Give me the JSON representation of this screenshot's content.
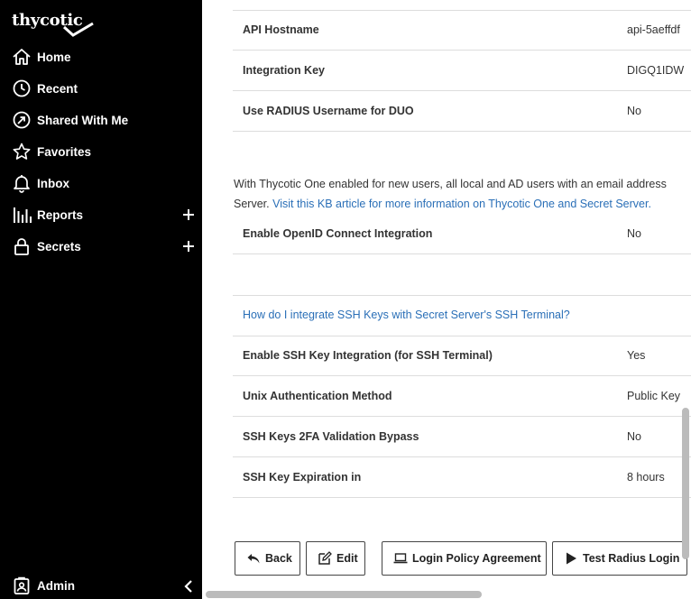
{
  "sidebar": {
    "logo": "thycotic",
    "items": [
      {
        "label": "Home"
      },
      {
        "label": "Recent"
      },
      {
        "label": "Shared With Me"
      },
      {
        "label": "Favorites"
      },
      {
        "label": "Inbox"
      },
      {
        "label": "Reports"
      },
      {
        "label": "Secrets"
      }
    ],
    "admin": "Admin"
  },
  "settings": {
    "api_hostname": {
      "label": "API Hostname",
      "value": "api-5aeffdf"
    },
    "integration_key": {
      "label": "Integration Key",
      "value": "DIGQ1IDW"
    },
    "radius_duo": {
      "label": "Use RADIUS Username for DUO",
      "value": "No"
    },
    "paragraph_text": "With Thycotic One enabled for new users, all local and AD users with an email address",
    "paragraph_text2": "Server. ",
    "paragraph_link": "Visit this KB article for more information on Thycotic One and Secret Server.",
    "openid": {
      "label": "Enable OpenID Connect Integration",
      "value": "No"
    },
    "ssh_kb_link": "How do I integrate SSH Keys with Secret Server's SSH Terminal?",
    "ssh_key_integration": {
      "label": "Enable SSH Key Integration (for SSH Terminal)",
      "value": "Yes"
    },
    "unix_auth": {
      "label": "Unix Authentication Method",
      "value": "Public Key"
    },
    "ssh_2fa": {
      "label": "SSH Keys 2FA Validation Bypass",
      "value": "No"
    },
    "ssh_expiration": {
      "label": "SSH Key Expiration in",
      "value": "8 hours"
    }
  },
  "buttons": {
    "back": "Back",
    "edit": "Edit",
    "login_policy": "Login Policy Agreement",
    "test_radius": "Test Radius Login"
  }
}
